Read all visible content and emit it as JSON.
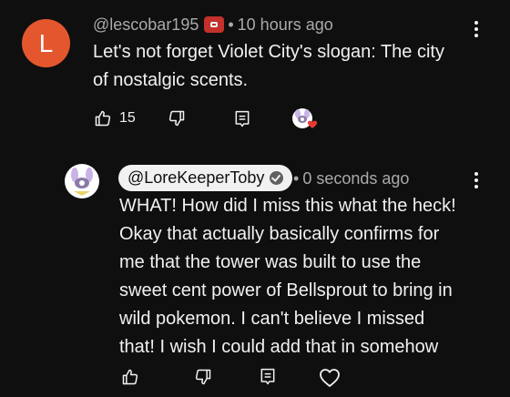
{
  "comment": {
    "avatar_letter": "L",
    "avatar_color": "#e4572e",
    "author": "@lescobar195",
    "time": "10 hours ago",
    "text_line1": "Let's not forget Violet City's slogan: The city",
    "text_line2": "of nostalgic scents.",
    "like_count": "15",
    "icons": [
      "thumbs-up-icon",
      "thumbs-down-icon",
      "reply-icon",
      "creator-heart-icon",
      "more-vert-icon",
      "member-badge-icon"
    ]
  },
  "reply": {
    "author": "@LoreKeeperToby",
    "time": "0 seconds ago",
    "lines": [
      "WHAT! How did I miss this what the heck!",
      "Okay that actually basically confirms for",
      "me that the tower was built to use the",
      "sweet cent power of Bellsprout to bring in",
      "wild pokemon. I can't believe I missed",
      "that! I wish I could add that in somehow"
    ],
    "icons": [
      "thumbs-up-icon",
      "thumbs-down-icon",
      "reply-icon",
      "heart-outline-icon",
      "more-vert-icon",
      "verified-icon"
    ]
  },
  "separator": "•"
}
